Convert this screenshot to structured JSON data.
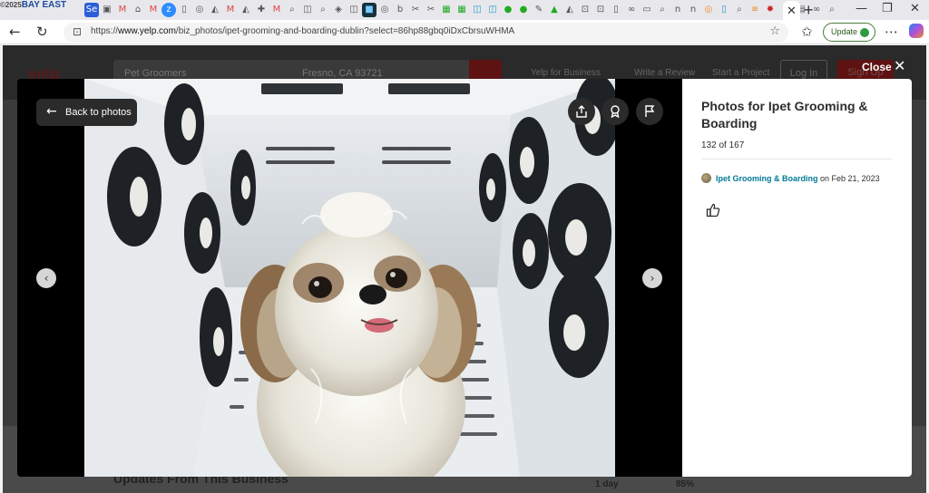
{
  "browser": {
    "corner_logo": "©2025",
    "corner_brand": "BAY EAST",
    "tab_close_label": "✕",
    "new_tab_label": "+",
    "url_prefix": "https://",
    "url_domain": "www.yelp.com",
    "url_path": "/biz_photos/ipet-grooming-and-boarding-dublin?select=86hp88gbq0iDxCbrsuWHMA",
    "update_label": "Update"
  },
  "yelp_page": {
    "logo": "yelp",
    "search_query": "Pet Groomers",
    "search_location": "Fresno, CA 93721",
    "nav": {
      "business": "Yelp for Business",
      "write_review": "Write a Review",
      "start_project": "Start a Project",
      "login": "Log In",
      "signup": "Sign Up"
    },
    "updates_heading": "Updates From This Business",
    "stat_day": "1 day",
    "stat_percent": "85%"
  },
  "modal": {
    "close_label": "Close",
    "back_label": "Back to photos",
    "title": "Photos for Ipet Grooming & Boarding",
    "count": "132 of 167",
    "author": "Ipet Grooming & Boarding",
    "date_prefix": "on",
    "date": "Feb 21, 2023"
  },
  "colors": {
    "yelp_red": "#d32323",
    "link_teal": "#027a97",
    "update_green": "#2e9b3e"
  },
  "icons": [
    "share-icon",
    "award-icon",
    "flag-icon",
    "chevron-left-icon",
    "chevron-right-icon",
    "thumbs-up-icon"
  ]
}
